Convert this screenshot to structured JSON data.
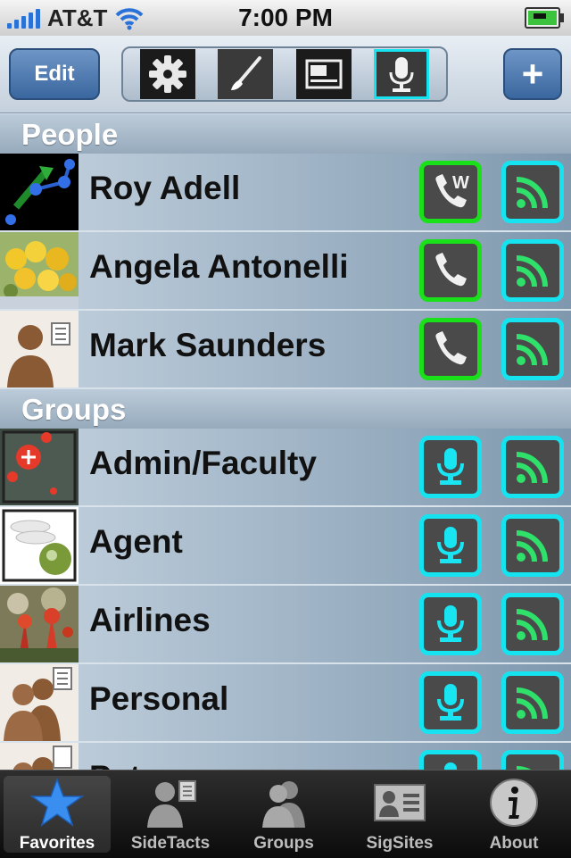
{
  "status": {
    "carrier": "AT&T",
    "time": "7:00 PM"
  },
  "toolbar": {
    "edit_label": "Edit",
    "add_label": "+",
    "segments": [
      "gear-icon",
      "brush-icon",
      "card-icon",
      "microphone-icon"
    ],
    "selected_segment": "microphone-icon"
  },
  "sections": {
    "people": "People",
    "groups": "Groups"
  },
  "people": [
    {
      "name": "Roy Adell",
      "call_icon": "phone-w-icon"
    },
    {
      "name": "Angela Antonelli",
      "call_icon": "phone-icon"
    },
    {
      "name": "Mark Saunders",
      "call_icon": "phone-icon"
    }
  ],
  "groups": [
    {
      "name": "Admin/Faculty"
    },
    {
      "name": "Agent"
    },
    {
      "name": "Airlines"
    },
    {
      "name": "Personal"
    },
    {
      "name": "Pet"
    }
  ],
  "tabs": [
    {
      "label": "Favorites",
      "icon": "star-icon",
      "active": true
    },
    {
      "label": "SideTacts",
      "icon": "person-card-icon",
      "active": false
    },
    {
      "label": "Groups",
      "icon": "people-icon",
      "active": false
    },
    {
      "label": "SigSites",
      "icon": "id-card-icon",
      "active": false
    },
    {
      "label": "About",
      "icon": "info-icon",
      "active": false
    }
  ],
  "colors": {
    "call_border": "#19e019",
    "feed_border": "#16e3f0",
    "feed_icon": "#2fe06a"
  }
}
